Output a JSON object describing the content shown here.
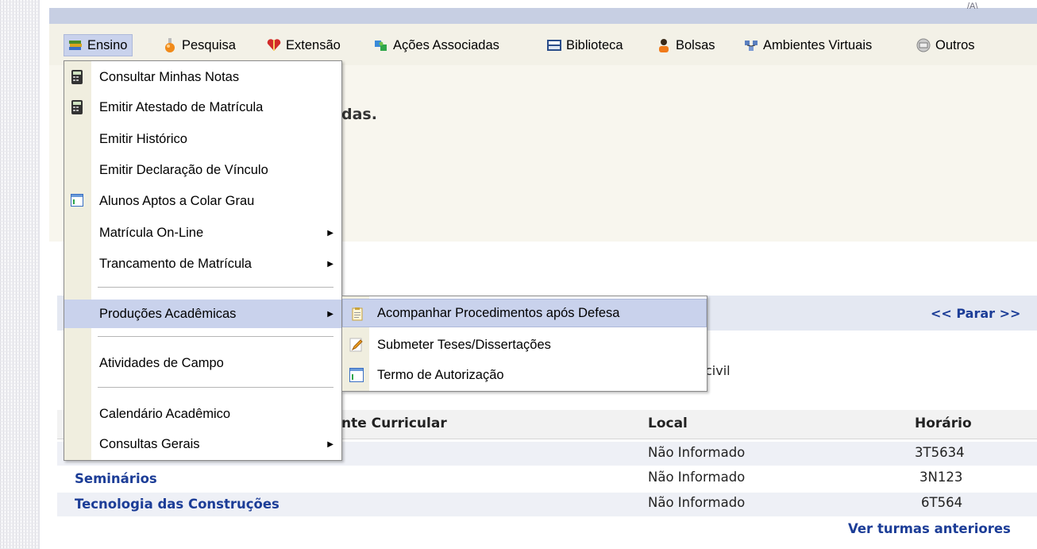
{
  "top_glyph": "/A\\",
  "menubar": {
    "items": [
      {
        "label": "Ensino",
        "icon": "books-icon"
      },
      {
        "label": "Pesquisa",
        "icon": "flask-icon"
      },
      {
        "label": "Extensão",
        "icon": "heart-gift-icon"
      },
      {
        "label": "Ações Associadas",
        "icon": "puzzle-icon"
      },
      {
        "label": "Biblioteca",
        "icon": "book-icon"
      },
      {
        "label": "Bolsas",
        "icon": "person-icon"
      },
      {
        "label": "Ambientes Virtuais",
        "icon": "network-icon"
      },
      {
        "label": "Outros",
        "icon": "printer-icon"
      }
    ]
  },
  "background": {
    "fragment_das": "das.",
    "parar": "<< Parar >>",
    "civil_fragment": "civil"
  },
  "table": {
    "headers": [
      "nte Curricular",
      "Local",
      "Horário"
    ],
    "rows": [
      {
        "name": "",
        "local": "Não Informado",
        "horario": "3T5634"
      },
      {
        "name": "Seminários",
        "local": "Não Informado",
        "horario": "3N123"
      },
      {
        "name": "Tecnologia das Construções",
        "local": "Não Informado",
        "horario": "6T564"
      }
    ],
    "ver_anteriores": "Ver turmas anteriores"
  },
  "dropdown": {
    "items": [
      {
        "label": "Consultar Minhas Notas",
        "icon": "calculator-icon",
        "submenu": false
      },
      {
        "label": "Emitir Atestado de Matrícula",
        "icon": "calculator-icon",
        "submenu": false
      },
      {
        "label": "Emitir Histórico",
        "icon": "",
        "submenu": false
      },
      {
        "label": "Emitir Declaração de Vínculo",
        "icon": "",
        "submenu": false
      },
      {
        "label": "Alunos Aptos a Colar Grau",
        "icon": "form-icon",
        "submenu": false
      },
      {
        "label": "Matrícula On-Line",
        "icon": "",
        "submenu": true
      },
      {
        "label": "Trancamento de Matrícula",
        "icon": "",
        "submenu": true
      },
      {
        "label": "Produções Acadêmicas",
        "icon": "",
        "submenu": true,
        "highlighted": true
      },
      {
        "label": "Atividades de Campo",
        "icon": "",
        "submenu": false
      },
      {
        "label": "Calendário Acadêmico",
        "icon": "",
        "submenu": false
      },
      {
        "label": "Consultas Gerais",
        "icon": "",
        "submenu": true
      }
    ]
  },
  "submenu": {
    "items": [
      {
        "label": "Acompanhar Procedimentos após Defesa",
        "icon": "clipboard-icon",
        "highlighted": true
      },
      {
        "label": "Submeter Teses/Dissertações",
        "icon": "pencil-icon"
      },
      {
        "label": "Termo de Autorização",
        "icon": "form-icon"
      }
    ]
  },
  "colors": {
    "highlight": "#c9d2ec",
    "link": "#1c3d97",
    "menubar_bg": "#f3f1e7"
  }
}
